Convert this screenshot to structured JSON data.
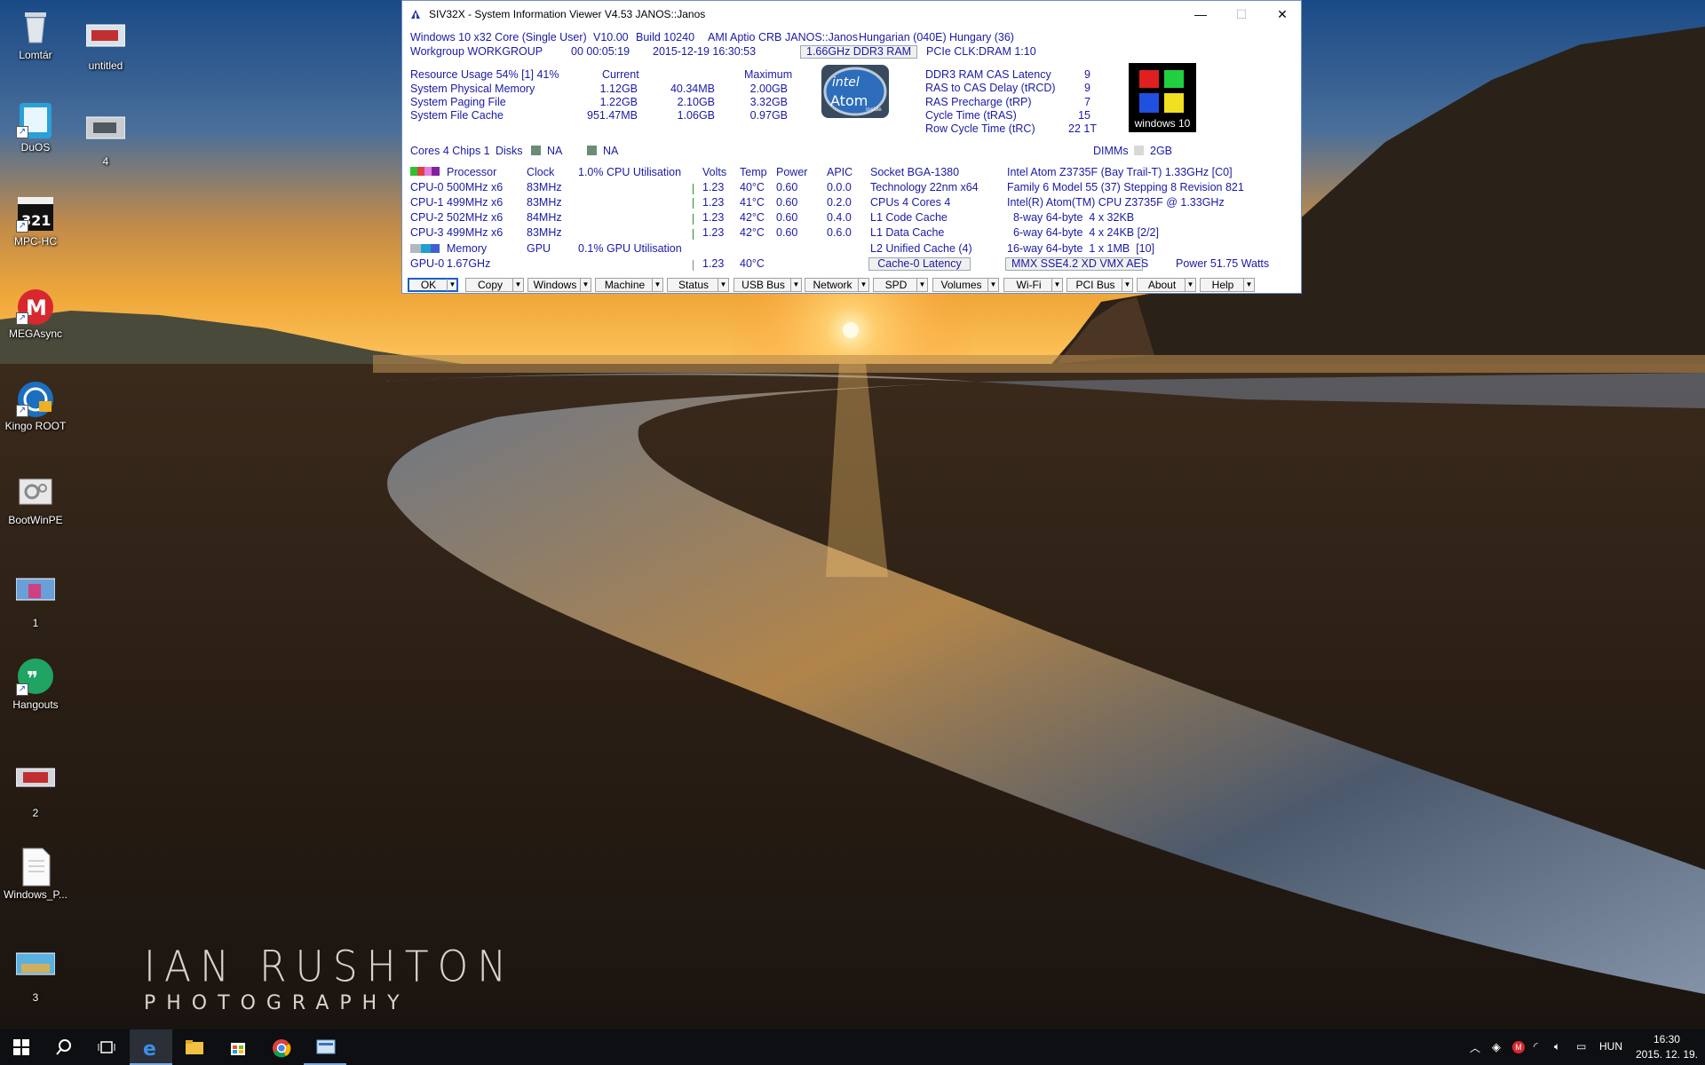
{
  "desktop": {
    "icons": [
      {
        "label": "Lomtár"
      },
      {
        "label": "untitled"
      },
      {
        "label": "DuOS"
      },
      {
        "label": "4"
      },
      {
        "label": "MPC-HC"
      },
      {
        "label": "MEGAsync"
      },
      {
        "label": "Kingo ROOT"
      },
      {
        "label": "BootWinPE"
      },
      {
        "label": "1"
      },
      {
        "label": "Hangouts"
      },
      {
        "label": "2"
      },
      {
        "label": "Windows_P..."
      },
      {
        "label": "3"
      }
    ],
    "watermark": {
      "line1": "IAN RUSHTON",
      "line2": "PHOTOGRAPHY"
    }
  },
  "window": {
    "title": "SIV32X - System Information Viewer V4.53 JANOS::Janos",
    "controls": {
      "minimize": "—",
      "maximize": "☐",
      "close": "✕"
    },
    "header": {
      "os": "Windows 10 x32 Core (Single User)",
      "version": "V10.00",
      "build": "Build 10240",
      "bios": "AMI Aptio CRB",
      "machine": "JANOS::Janos",
      "language": "Hungarian (040E)",
      "region": "Hungary (36)",
      "workgroup": "Workgroup WORKGROUP",
      "uptime": "00 00:05:19",
      "datetime": "2015-12-19 16:30:53",
      "ram": "1.66GHz DDR3 RAM",
      "pcie": "PCIe CLK:DRAM 1:10"
    },
    "resources": {
      "title": "Resource Usage 54% [1] 41%",
      "col_current": "Current",
      "col_maximum": "Maximum",
      "rows": [
        {
          "label": "System Physical Memory",
          "current": "1.12GB",
          "free": "40.34MB",
          "maximum": "2.00GB"
        },
        {
          "label": "System Paging File",
          "current": "1.22GB",
          "free": "2.10GB",
          "maximum": "3.32GB"
        },
        {
          "label": "System File Cache",
          "current": "951.47MB",
          "free": "1.06GB",
          "maximum": "0.97GB"
        }
      ]
    },
    "intel_logo": {
      "brand": "intel",
      "model": "Atom",
      "tag": "inside"
    },
    "timings": [
      {
        "label": "DDR3 RAM CAS Latency",
        "value": "9"
      },
      {
        "label": "RAS to CAS Delay (tRCD)",
        "value": "9"
      },
      {
        "label": "RAS Precharge (tRP)",
        "value": "7"
      },
      {
        "label": "Cycle Time (tRAS)",
        "value": "15"
      },
      {
        "label": "Row Cycle Time (tRC)",
        "value": "22 1T"
      }
    ],
    "win_logo": {
      "label": "windows 10",
      "colors": [
        "#e02020",
        "#20d040",
        "#2050e0",
        "#f0e020"
      ]
    },
    "summary": {
      "cores": "Cores 4 Chips 1",
      "disks": "Disks",
      "disk1": "NA",
      "disk2": "NA",
      "dimms": "DIMMs",
      "dimm_size": "2GB"
    },
    "cpu_table": {
      "headers": {
        "processor": "Processor",
        "clock": "Clock",
        "util": "1.0% CPU Utilisation",
        "volts": "Volts",
        "temp": "Temp",
        "power": "Power",
        "apic": "APIC"
      },
      "rows": [
        {
          "name": "CPU-0",
          "freq": "500MHz x6",
          "clock": "83MHz",
          "volts": "1.23",
          "temp": "40°C",
          "power": "0.60",
          "apic": "0.0.0"
        },
        {
          "name": "CPU-1",
          "freq": "499MHz x6",
          "clock": "83MHz",
          "volts": "1.23",
          "temp": "41°C",
          "power": "0.60",
          "apic": "0.2.0"
        },
        {
          "name": "CPU-2",
          "freq": "502MHz x6",
          "clock": "84MHz",
          "volts": "1.23",
          "temp": "42°C",
          "power": "0.60",
          "apic": "0.4.0"
        },
        {
          "name": "CPU-3",
          "freq": "499MHz x6",
          "clock": "83MHz",
          "volts": "1.23",
          "temp": "42°C",
          "power": "0.60",
          "apic": "0.6.0"
        }
      ],
      "memory": "Memory",
      "gpu": "GPU",
      "gpu_util": "0.1% GPU Utilisation",
      "gpu0": {
        "name": "GPU-0",
        "freq": "1.67GHz",
        "volts": "1.23",
        "temp": "40°C"
      }
    },
    "socket": [
      {
        "left": "Socket BGA-1380",
        "right": "Intel Atom Z3735F (Bay Trail-T) 1.33GHz [C0]"
      },
      {
        "left": "Technology 22nm  x64",
        "right": "Family 6  Model 55 (37)  Stepping 8  Revision 821"
      },
      {
        "left": "CPUs 4 Cores 4",
        "right": "Intel(R) Atom(TM) CPU Z3735F @ 1.33GHz"
      },
      {
        "left": "L1 Code Cache",
        "right": "  8-way 64-byte  4 x 32KB"
      },
      {
        "left": "L1 Data Cache",
        "right": "  6-way 64-byte  4 x 24KB [2/2]"
      },
      {
        "left": "L2 Unified Cache (4)",
        "right": "16-way 64-byte  1 x 1MB  [10]"
      }
    ],
    "cache_latency": "Cache-0 Latency",
    "features": "MMX SSE4.2 XD VMX AES",
    "power": "Power  51.75 Watts",
    "toolbar": [
      "OK",
      "Copy",
      "Windows",
      "Machine",
      "Status",
      "USB Bus",
      "Network",
      "SPD",
      "Volumes",
      "Wi-Fi",
      "PCI Bus",
      "About",
      "Help"
    ]
  },
  "taskbar": {
    "language": "HUN",
    "time": "16:30",
    "date": "2015. 12. 19."
  }
}
